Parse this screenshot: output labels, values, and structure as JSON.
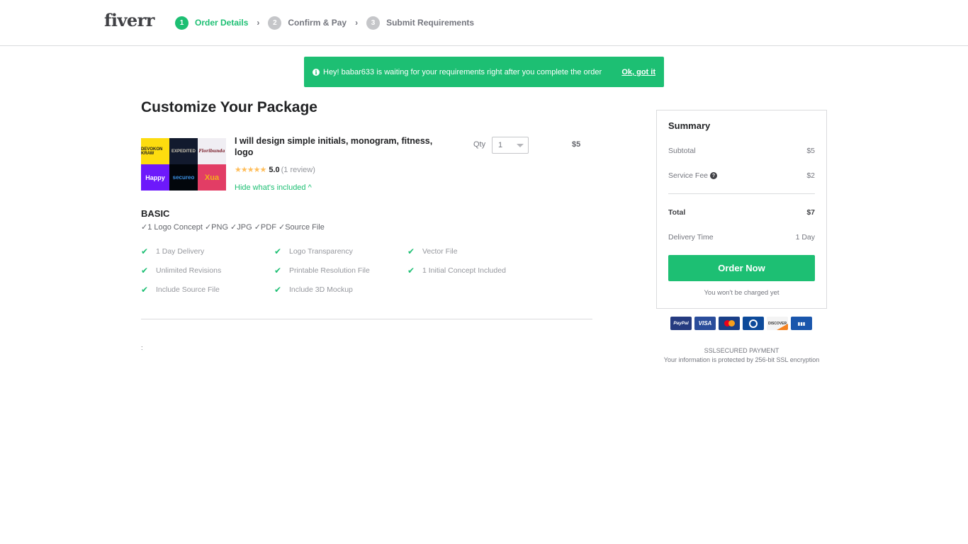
{
  "header": {
    "logo": "fiverr",
    "steps": [
      {
        "num": "1",
        "label": "Order Details",
        "active": true
      },
      {
        "num": "2",
        "label": "Confirm & Pay",
        "active": false
      },
      {
        "num": "3",
        "label": "Submit Requirements",
        "active": false
      }
    ],
    "separator": "›"
  },
  "banner": {
    "icon": "info-icon",
    "message": "Hey! babar633 is waiting for your requirements right after you complete the order",
    "dismiss_label": "Ok, got it"
  },
  "main": {
    "title": "Customize Your Package",
    "gig": {
      "title": "I will design simple initials, monogram, fitness, logo",
      "thumbnails": [
        "DEVOKON KRAW",
        "EXPEDITED",
        "Floribunda",
        "Happy",
        "secureo",
        "Xua"
      ],
      "stars": "★★★★★",
      "rating": "5.0",
      "review_count": "(1 review)",
      "toggle_label": "Hide what's included ^",
      "qty_label": "Qty",
      "qty_value": "1",
      "price": "$5"
    },
    "package": {
      "name": "BASIC",
      "description": "✓1 Logo Concept ✓PNG ✓JPG ✓PDF ✓Source File",
      "features": [
        "1 Day Delivery",
        "Logo Transparency",
        "Vector File",
        "Unlimited Revisions",
        "Printable Resolution File",
        "1 Initial Concept Included",
        "Include Source File",
        "Include 3D Mockup"
      ]
    },
    "stray_text": ":"
  },
  "summary": {
    "title": "Summary",
    "subtotal_label": "Subtotal",
    "subtotal_value": "$5",
    "fee_label": "Service Fee",
    "fee_value": "$2",
    "total_label": "Total",
    "total_value": "$7",
    "delivery_label": "Delivery Time",
    "delivery_value": "1 Day",
    "order_button": "Order Now",
    "no_charge_note": "You won't be charged yet"
  },
  "payment": {
    "cards": [
      "PayPal",
      "VISA",
      "MasterCard",
      "Diners Club",
      "DISCOVER",
      "JCB"
    ],
    "ssl_title": "SSLSECURED PAYMENT",
    "ssl_desc": "Your information is protected by 256-bit SSL encryption"
  },
  "colors": {
    "brand_green": "#1dbf73",
    "star_yellow": "#ffbe5b"
  }
}
